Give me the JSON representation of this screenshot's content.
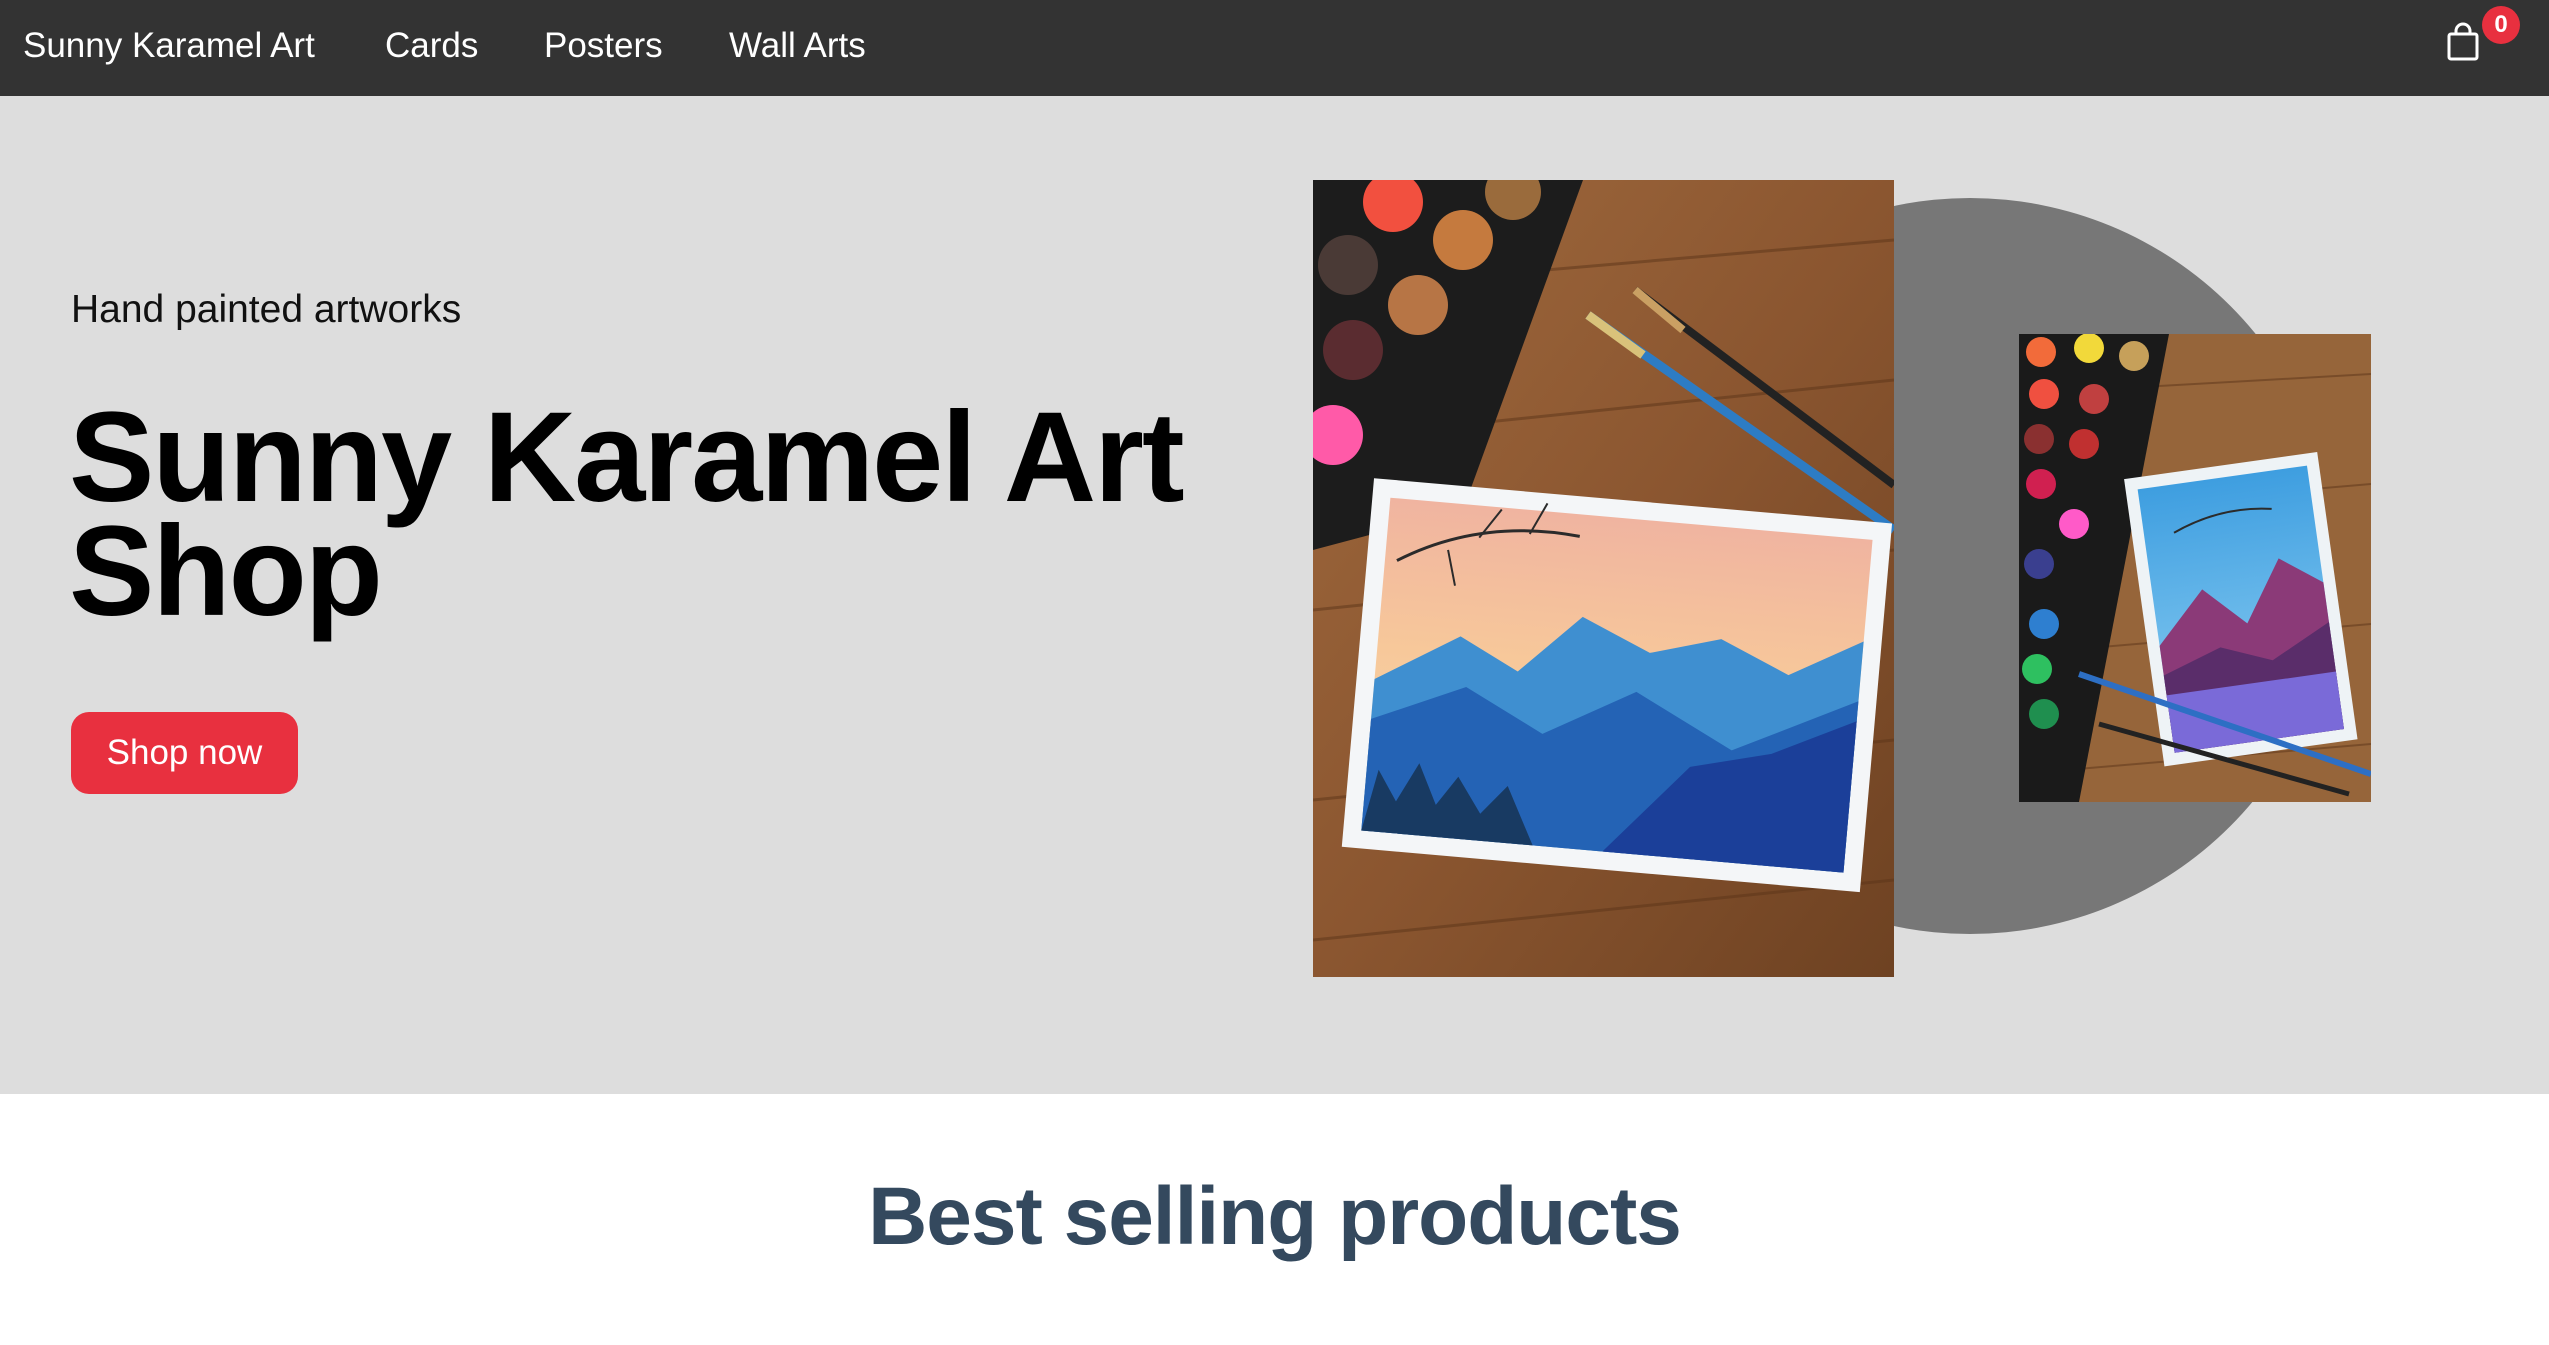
{
  "nav": {
    "brand": "Sunny Karamel Art",
    "links": [
      "Cards",
      "Posters",
      "Wall Arts"
    ],
    "cart_icon": "shopping-bag-icon",
    "cart_count": "0"
  },
  "hero": {
    "tagline": "Hand painted artworks",
    "title": "Sunny Karamel Art Shop",
    "button_label": "Shop now",
    "image_main_alt": "Watercolor painting of blue mountains at sunset with brushes and paint palette",
    "image_small_alt": "Watercolor painting of purple mountains over a lake with brushes and paint palette"
  },
  "best_selling": {
    "title": "Best selling products"
  },
  "colors": {
    "nav_bg": "#333333",
    "hero_bg": "#dddddd",
    "accent": "#e8303f",
    "section_title": "#34495e",
    "circle": "#777777"
  }
}
